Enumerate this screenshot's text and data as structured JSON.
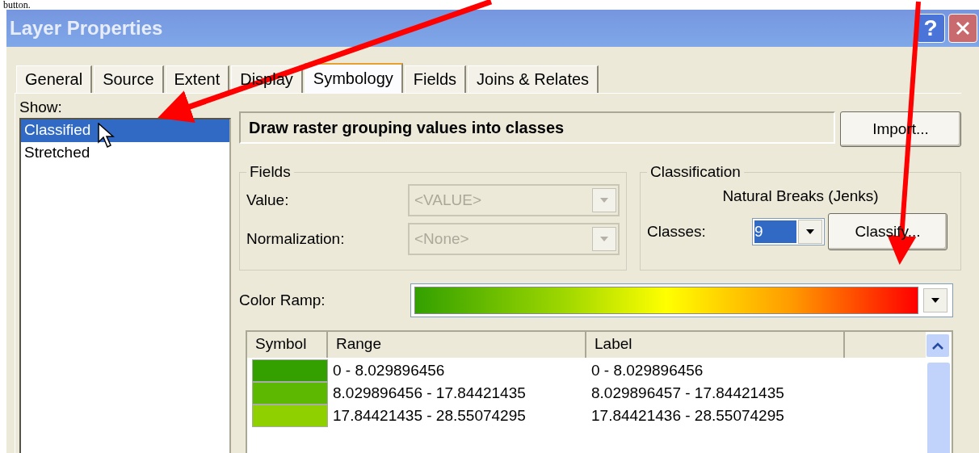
{
  "document_text": "button.",
  "window": {
    "title": "Layer Properties",
    "help_button": "?"
  },
  "tabs": [
    {
      "label": "General",
      "selected": false
    },
    {
      "label": "Source",
      "selected": false
    },
    {
      "label": "Extent",
      "selected": false
    },
    {
      "label": "Display",
      "selected": false
    },
    {
      "label": "Symbology",
      "selected": true
    },
    {
      "label": "Fields",
      "selected": false
    },
    {
      "label": "Joins & Relates",
      "selected": false
    }
  ],
  "show": {
    "label": "Show:",
    "items": [
      {
        "label": "Classified",
        "selected": true
      },
      {
        "label": "Stretched",
        "selected": false
      }
    ]
  },
  "description": "Draw raster grouping values into classes",
  "import_button": "Import...",
  "fields": {
    "title": "Fields",
    "rows": [
      {
        "label": "Value:",
        "value": "<VALUE>",
        "disabled": true
      },
      {
        "label": "Normalization:",
        "value": "<None>",
        "disabled": true
      }
    ]
  },
  "classification": {
    "title": "Classification",
    "method": "Natural Breaks (Jenks)",
    "classes_label": "Classes:",
    "classes_value": "9",
    "classify_button": "Classify..."
  },
  "color_ramp": {
    "label": "Color Ramp:"
  },
  "table": {
    "columns": [
      "Symbol",
      "Range",
      "Label"
    ],
    "rows": [
      {
        "color": "#33a000",
        "range": "0 - 8.029896456",
        "label": "0 - 8.029896456"
      },
      {
        "color": "#5cb800",
        "range": "8.029896456 - 17.84421435",
        "label": "8.029896457 - 17.84421435"
      },
      {
        "color": "#8fd000",
        "range": "17.84421435 - 28.55074295",
        "label": "17.84421436 - 28.55074295"
      }
    ]
  }
}
